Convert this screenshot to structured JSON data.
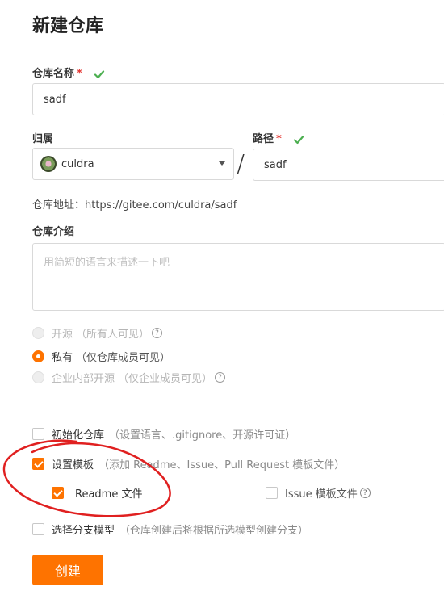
{
  "page": {
    "title": "新建仓库"
  },
  "repo_name": {
    "label": "仓库名称",
    "required_mark": "*",
    "value": "sadf"
  },
  "owner": {
    "label": "归属",
    "value": "culdra"
  },
  "separator": "/",
  "path": {
    "label": "路径",
    "required_mark": "*",
    "value": "sadf"
  },
  "repo_url": "仓库地址：https://gitee.com/culdra/sadf",
  "description": {
    "label": "仓库介绍",
    "placeholder": "用简短的语言来描述一下吧"
  },
  "visibility": {
    "options": [
      {
        "label": "开源",
        "hint": "（所有人可见）",
        "state": "disabled"
      },
      {
        "label": "私有",
        "hint": "（仅仓库成员可见）",
        "state": "checked"
      },
      {
        "label": "企业内部开源",
        "hint": "（仅企业成员可见）",
        "state": "disabled"
      }
    ]
  },
  "init_repo": {
    "label": "初始化仓库",
    "hint": "（设置语言、.gitignore、开源许可证）",
    "checked": false
  },
  "template": {
    "label": "设置模板",
    "hint": "（添加 Readme、Issue、Pull Request 模板文件）",
    "checked": true,
    "readme": {
      "label": "Readme 文件",
      "checked": true
    },
    "issue": {
      "label": "Issue 模板文件",
      "checked": false
    }
  },
  "branch_model": {
    "label": "选择分支模型",
    "hint": "（仓库创建后将根据所选模型创建分支）",
    "checked": false
  },
  "create_button": "创建",
  "colors": {
    "accent": "#fe7300",
    "valid": "#4caf50",
    "annotation": "#e02020"
  },
  "icons": {
    "valid": "check-icon",
    "help": "question-circle-icon",
    "dropdown": "caret-down-icon"
  }
}
